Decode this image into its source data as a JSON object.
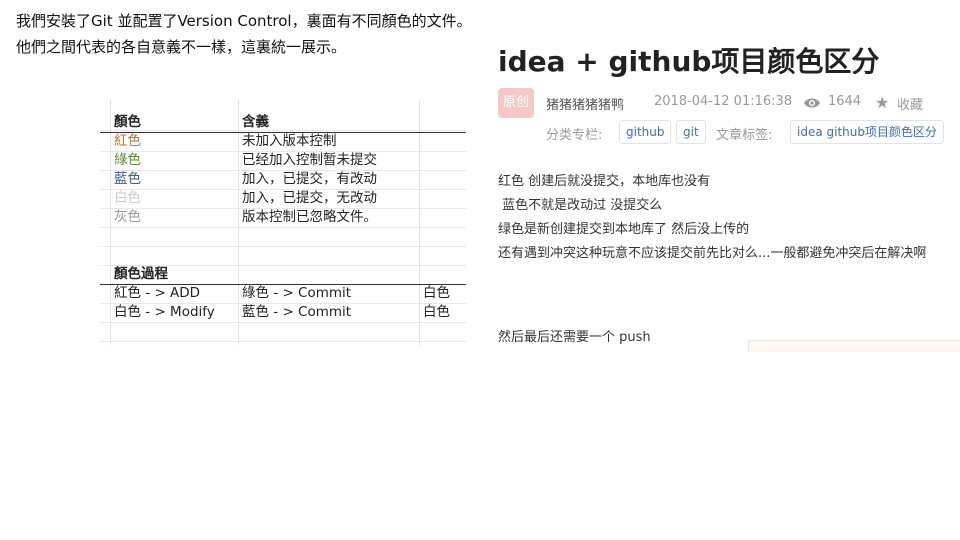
{
  "intro": {
    "line1": "我們安裝了Git 並配置了Version Control，裏面有不同顏色的文件。",
    "line2": "他們之間代表的各自意義不一樣，這裏統一展示。"
  },
  "sheet": {
    "header": [
      "顏色",
      "含義"
    ],
    "rows": [
      {
        "color_name": "紅色",
        "meaning": "未加入版本控制",
        "color": "#c0713a"
      },
      {
        "color_name": "綠色",
        "meaning": "已经加入控制暂未提交",
        "color": "#5b8c2e"
      },
      {
        "color_name": "藍色",
        "meaning": "加入，已提交，有改动",
        "color": "#3a5c8c"
      },
      {
        "color_name": "白色",
        "meaning": "加入，已提交，无改动",
        "color": "#cccccc"
      },
      {
        "color_name": "灰色",
        "meaning": "版本控制已忽略文件。",
        "color": "#9a9a9a"
      }
    ],
    "process_title": "顏色過程",
    "process_rows": [
      {
        "a": "紅色  - > ADD",
        "b": "綠色 - > Commit",
        "c": "白色"
      },
      {
        "a": "白色  - > Modify",
        "b": "藍色 - > Commit",
        "c": "白色"
      }
    ]
  },
  "blog": {
    "title": "idea + github项目颜色区分",
    "badge": "原创",
    "author": "猪猪猪猪猪鸭",
    "date": "2018-04-12 01:16:38",
    "views": "1644",
    "favorite": "收藏",
    "category_label": "分类专栏:",
    "categories": [
      "github",
      "git"
    ],
    "tags_label": "文章标签:",
    "tags": [
      "idea github项目颜色区分"
    ],
    "content": [
      "红色 创建后就没提交，本地库也没有",
      " 蓝色不就是改动过 没提交么",
      "绿色是新创建提交到本地库了 然后没上传的",
      "还有遇到冲突这种玩意不应该提交前先比对么...一般都避免冲突后在解决啊",
      "然后最后还需要一个 push"
    ]
  },
  "icons": {
    "views": "eye-icon",
    "favorite": "star-icon"
  }
}
